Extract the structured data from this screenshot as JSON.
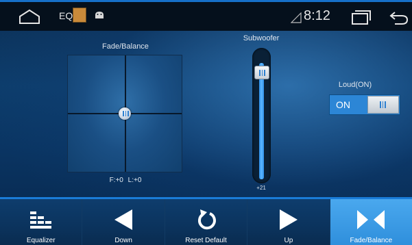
{
  "status_bar": {
    "app_label": "EQ",
    "time": "8:12"
  },
  "fade_balance": {
    "title": "Fade/Balance",
    "fade_value": "F:+0",
    "balance_value": "L:+0"
  },
  "subwoofer": {
    "title": "Subwoofer",
    "value": "+21"
  },
  "loud": {
    "title": "Loud(ON)",
    "state_label": "ON"
  },
  "tabs": [
    {
      "label": "Equalizer",
      "icon": "equalizer-icon",
      "active": false
    },
    {
      "label": "Down",
      "icon": "triangle-left-icon",
      "active": false
    },
    {
      "label": "Reset Default",
      "icon": "reset-icon",
      "active": false
    },
    {
      "label": "Up",
      "icon": "triangle-right-icon",
      "active": false
    },
    {
      "label": "Fade/Balance",
      "icon": "fade-balance-icon",
      "active": true
    }
  ],
  "colors": {
    "accent": "#2f8fdc",
    "status_bar": "#05101c",
    "background": "#0d3d6c"
  }
}
